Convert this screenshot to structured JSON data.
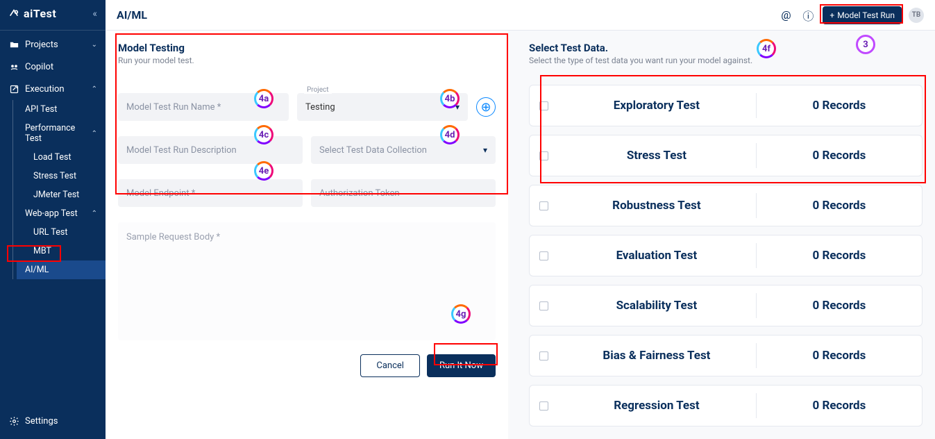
{
  "brand": "aiTest",
  "sidebar": {
    "projects": "Projects",
    "copilot": "Copilot",
    "execution": "Execution",
    "api_test": "API Test",
    "perf_test": "Performance Test",
    "load_test": "Load Test",
    "stress_test": "Stress Test",
    "jmeter_test": "JMeter Test",
    "webapp_test": "Web-app Test",
    "url_test": "URL Test",
    "mbt": "MBT",
    "aiml": "AI/ML",
    "settings": "Settings"
  },
  "header": {
    "title": "AI/ML",
    "button": "Model Test Run",
    "avatar": "TB"
  },
  "left_panel": {
    "title": "Model Testing",
    "sub": "Run your model test.",
    "name_ph": "Model Test Run Name *",
    "project_label": "Project",
    "project_value": "Testing",
    "desc_ph": "Model Test Run Description",
    "collection_ph": "Select Test Data Collection",
    "endpoint_ph": "Model Endpoint *",
    "auth_ph": "Authorization Token",
    "body_ph": "Sample Request Body *",
    "cancel": "Cancel",
    "submit": "Run It Now"
  },
  "right_panel": {
    "title": "Select Test Data.",
    "sub": "Select the type of test data you want run your model against.",
    "rec_label": "0 Records",
    "cards": [
      {
        "name": "Exploratory Test"
      },
      {
        "name": "Stress Test"
      },
      {
        "name": "Robustness Test"
      },
      {
        "name": "Evaluation Test"
      },
      {
        "name": "Scalability Test"
      },
      {
        "name": "Bias & Fairness Test"
      },
      {
        "name": "Regression Test"
      }
    ]
  },
  "annotations": {
    "c3": "3",
    "c4a": "4a",
    "c4b": "4b",
    "c4c": "4c",
    "c4d": "4d",
    "c4e": "4e",
    "c4f": "4f",
    "c4g": "4g"
  }
}
